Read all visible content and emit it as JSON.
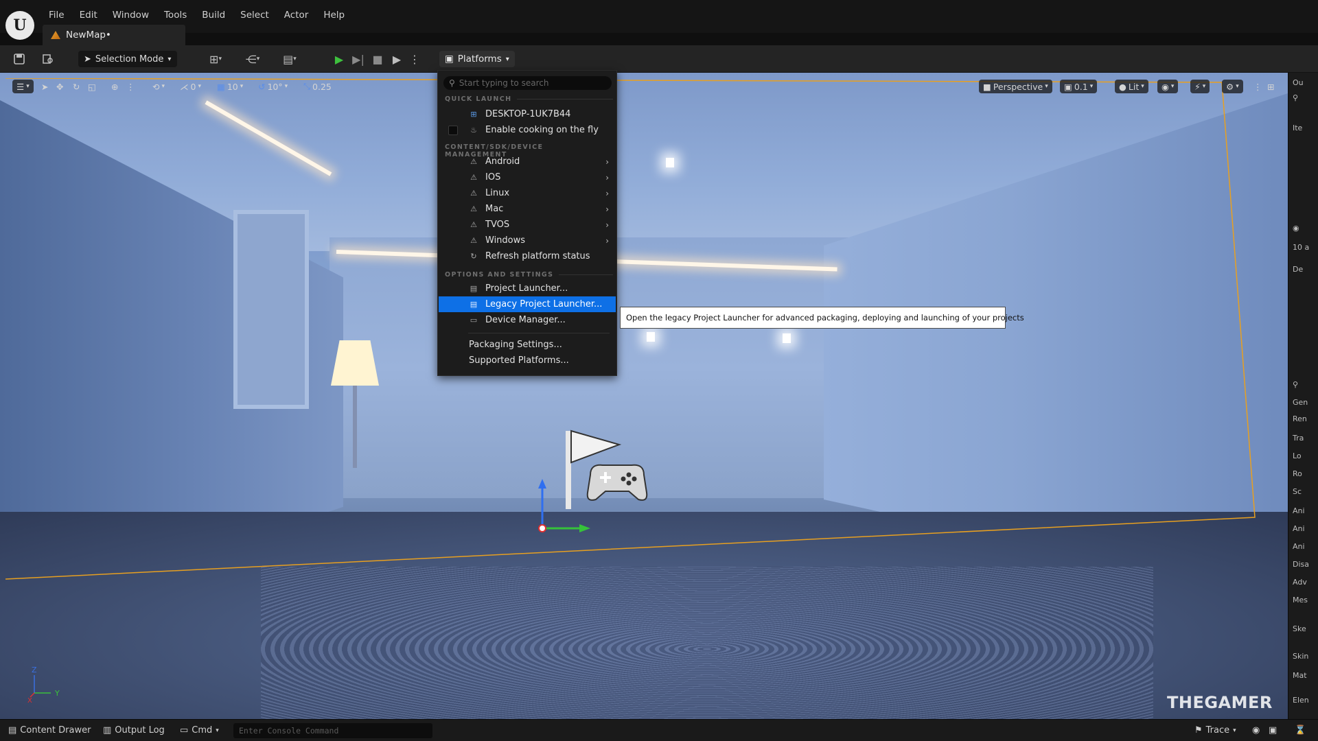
{
  "menubar": {
    "items": [
      "File",
      "Edit",
      "Window",
      "Tools",
      "Build",
      "Select",
      "Actor",
      "Help"
    ],
    "doc_tab": "NewMap•"
  },
  "toolbar": {
    "selection_mode": "Selection Mode",
    "platforms": "Platforms"
  },
  "viewport_toolbar": {
    "snap_rotation": "0",
    "grid_snap": "10",
    "rotation_snap": "10°",
    "scale_snap": "0.25",
    "view_mode": "Perspective",
    "camera_speed": "0.1",
    "lighting": "Lit"
  },
  "platforms_menu": {
    "search_placeholder": "Start typing to search",
    "section_quick_launch": "QUICK LAUNCH",
    "device": "DESKTOP-1UK7B44",
    "cooking": "Enable cooking on the fly",
    "section_content": "CONTENT/SDK/DEVICE MANAGEMENT",
    "platforms": [
      "Android",
      "IOS",
      "Linux",
      "Mac",
      "TVOS",
      "Windows"
    ],
    "refresh": "Refresh platform status",
    "section_options": "OPTIONS AND SETTINGS",
    "project_launcher": "Project Launcher...",
    "legacy_launcher": "Legacy Project Launcher...",
    "device_manager": "Device Manager...",
    "packaging": "Packaging Settings...",
    "supported": "Supported Platforms..."
  },
  "tooltip": "Open the legacy Project Launcher for advanced packaging, deploying and launching of your projects",
  "right_panel": {
    "rows": [
      "Ou",
      "Ite",
      "10 a",
      "De",
      "Gen",
      "Ren",
      "Tra",
      "Lo",
      "Ro",
      "Sc",
      "Ani",
      "Ani",
      "Ani",
      "Disa",
      "Adv",
      "Mes",
      "Ske",
      "Skin",
      "Mat",
      "Elen"
    ]
  },
  "statusbar": {
    "content_drawer": "Content Drawer",
    "output_log": "Output Log",
    "cmd": "Cmd",
    "console_placeholder": "Enter Console Command",
    "trace": "Trace"
  },
  "watermark": "THEGAMER",
  "colors": {
    "highlight": "#0e70e6",
    "selection_outline": "#e8a020",
    "play": "#3ec13e"
  }
}
